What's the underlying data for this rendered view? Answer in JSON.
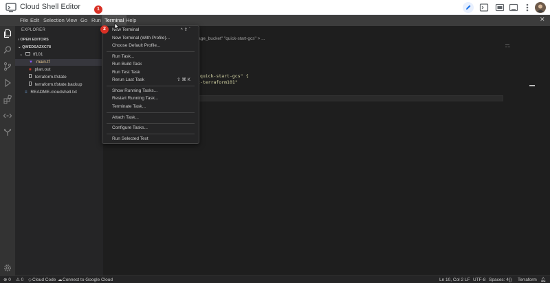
{
  "window": {
    "title": "Cloud Shell Editor"
  },
  "menubar": [
    "File",
    "Edit",
    "Selection",
    "View",
    "Go",
    "Run",
    "Terminal",
    "Help"
  ],
  "sidebar": {
    "header": "EXPLORER",
    "open_editors": "OPEN EDITORS",
    "workspace": "QWEDSAZXC78",
    "folder": "tf101",
    "files": [
      "main.tf",
      "plan.out",
      "terraform.tfstate",
      "terraform.tfstate.backup"
    ],
    "root_file": "README-cloudshell.txt"
  },
  "editor": {
    "breadcrumb": "rage_bucket\" \"quick-start-gcs\"  >  ...",
    "code": [
      "\"quick-start-gcs\" {",
      "t-terraform101\""
    ]
  },
  "terminal_menu": {
    "items": [
      {
        "label": "New Terminal",
        "key": "^ ⇧ `"
      },
      {
        "label": "New Terminal (With Profile)...",
        "key": ""
      },
      {
        "label": "Choose Default Profile...",
        "key": ""
      },
      {
        "label": "Run Task...",
        "key": ""
      },
      {
        "label": "Run Build Task",
        "key": ""
      },
      {
        "label": "Run Test Task",
        "key": ""
      },
      {
        "label": "Rerun Last Task",
        "key": "⇧ ⌘ K"
      },
      {
        "label": "Show Running Tasks...",
        "key": ""
      },
      {
        "label": "Restart Running Task...",
        "key": ""
      },
      {
        "label": "Terminate Task...",
        "key": ""
      },
      {
        "label": "Attach Task...",
        "key": ""
      },
      {
        "label": "Configure Tasks...",
        "key": ""
      },
      {
        "label": "Run Selected Text",
        "key": ""
      }
    ]
  },
  "badges": [
    "1",
    "2"
  ],
  "status": {
    "errors": "⊗ 0",
    "warnings": "⚠ 0",
    "cloud_code": "Cloud Code",
    "connect": "Connect to Google Cloud",
    "position": "Ln 10, Col 2",
    "eol": "LF",
    "encoding": "UTF-8",
    "spaces": "Spaces: 4",
    "braces": "{}",
    "language": "Terraform"
  },
  "colors": {
    "accent": "#d93025",
    "menu_bg": "#252526",
    "editor_bg": "#1e1e1e"
  }
}
